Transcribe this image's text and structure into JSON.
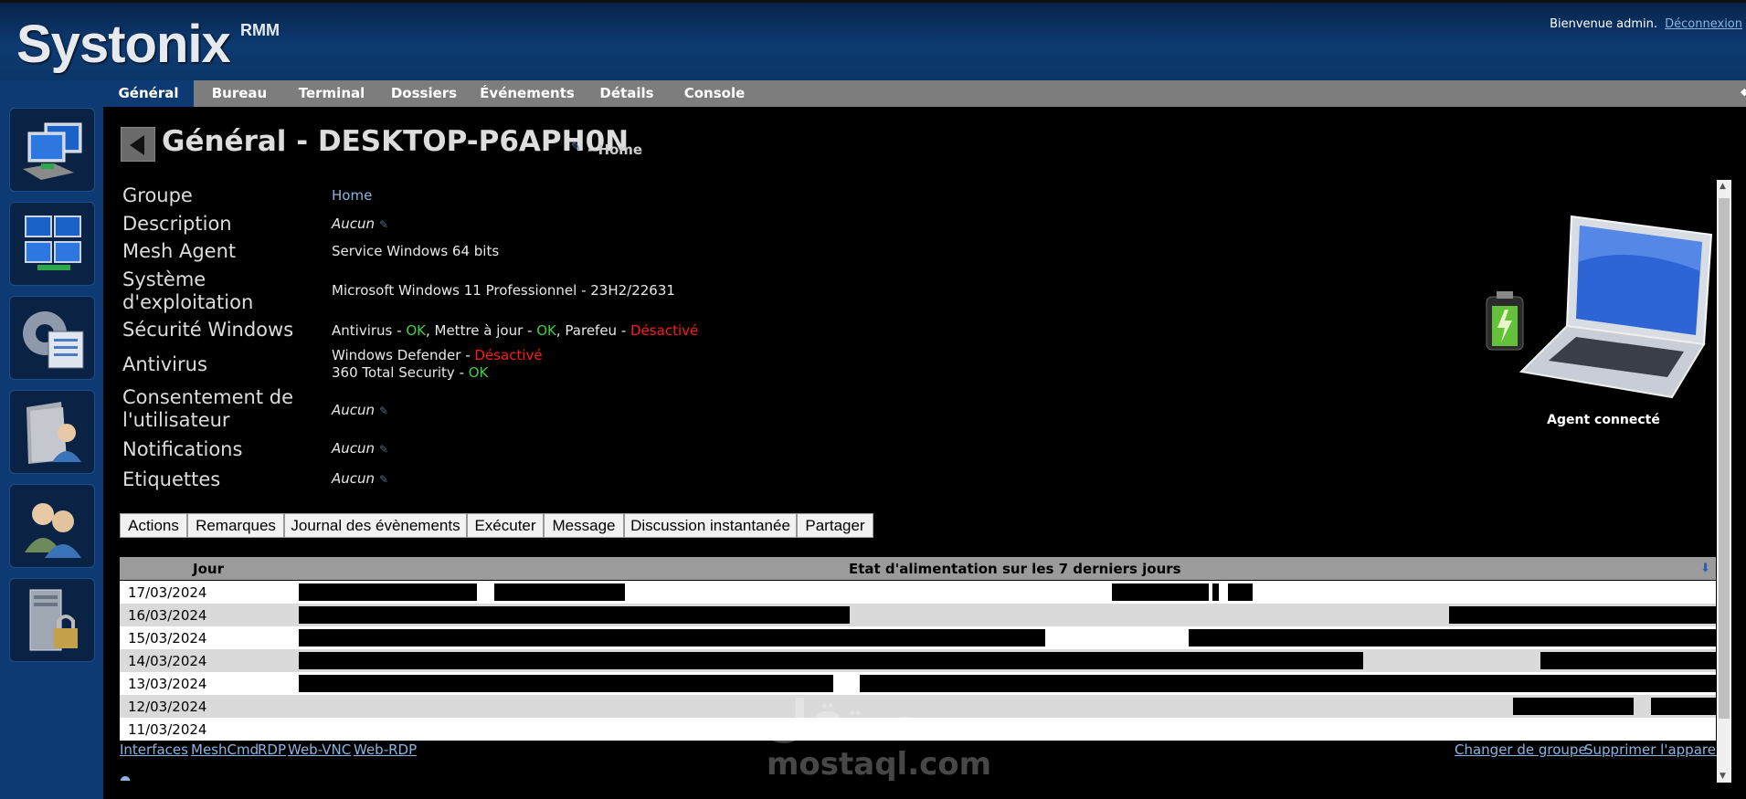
{
  "header": {
    "app_name": "Systonix",
    "app_suffix": "RMM",
    "welcome": "Bienvenue admin.",
    "logout": "Déconnexion"
  },
  "sidebar": {
    "items": [
      {
        "icon": "computers-network-icon"
      },
      {
        "icon": "multi-desktop-icon"
      },
      {
        "icon": "settings-gear-icon"
      },
      {
        "icon": "user-folder-icon"
      },
      {
        "icon": "users-icon"
      },
      {
        "icon": "server-lock-icon"
      }
    ]
  },
  "tabs": [
    {
      "label": "Général",
      "active": true
    },
    {
      "label": "Bureau"
    },
    {
      "label": "Terminal"
    },
    {
      "label": "Dossiers"
    },
    {
      "label": "Événements"
    },
    {
      "label": "Détails"
    },
    {
      "label": "Console"
    }
  ],
  "page": {
    "title": "Général - DESKTOP-P6APH0N",
    "group_suffix": "- Home"
  },
  "info": {
    "group_label": "Groupe",
    "group_value": "Home",
    "description_label": "Description",
    "description_value": "Aucun",
    "mesh_agent_label": "Mesh Agent",
    "mesh_agent_value": "Service Windows 64 bits",
    "os_label_1": "Système",
    "os_label_2": "d'exploitation",
    "os_value": "Microsoft Windows 11 Professionnel - 23H2/22631",
    "security_label": "Sécurité Windows",
    "security": {
      "antivirus": "Antivirus",
      "antivirus_status": "OK",
      "update": "Mettre à jour",
      "update_status": "OK",
      "firewall": "Parefeu",
      "firewall_status": "Désactivé"
    },
    "antivirus_label": "Antivirus",
    "antivirus_list": [
      {
        "name": "Windows Defender",
        "status": "Désactivé"
      },
      {
        "name": "360 Total Security",
        "status": "OK"
      }
    ],
    "consent_label_1": "Consentement de",
    "consent_label_2": "l'utilisateur",
    "consent_value": "Aucun",
    "notifications_label": "Notifications",
    "notifications_value": "Aucun",
    "tags_label": "Etiquettes",
    "tags_value": "Aucun"
  },
  "agent": {
    "status": "Agent connecté"
  },
  "actions": [
    "Actions",
    "Remarques",
    "Journal des évènements",
    "Exécuter",
    "Message",
    "Discussion instantanée",
    "Partager"
  ],
  "power": {
    "col_day": "Jour",
    "title": "Etat d'alimentation sur les 7 derniers jours",
    "rows": [
      {
        "date": "17/03/2024",
        "on_ranges": [
          [
            0.0,
            0.126
          ],
          [
            0.138,
            0.23
          ],
          [
            0.574,
            0.642
          ],
          [
            0.645,
            0.649
          ],
          [
            0.656,
            0.673
          ]
        ]
      },
      {
        "date": "16/03/2024",
        "on_ranges": [
          [
            0.0,
            0.389
          ],
          [
            0.812,
            1.0
          ]
        ]
      },
      {
        "date": "15/03/2024",
        "on_ranges": [
          [
            0.0,
            0.527
          ],
          [
            0.628,
            1.0
          ]
        ]
      },
      {
        "date": "14/03/2024",
        "on_ranges": [
          [
            0.0,
            0.751
          ],
          [
            0.876,
            1.0
          ]
        ]
      },
      {
        "date": "13/03/2024",
        "on_ranges": [
          [
            0.0,
            0.377
          ],
          [
            0.396,
            1.0
          ]
        ]
      },
      {
        "date": "12/03/2024",
        "on_ranges": [
          [
            0.857,
            0.942
          ],
          [
            0.954,
            1.0
          ]
        ]
      },
      {
        "date": "11/03/2024",
        "on_ranges": []
      }
    ]
  },
  "footer": {
    "left_links": [
      "Interfaces",
      "MeshCmd",
      "RDP",
      "Web-VNC",
      "Web-RDP"
    ],
    "right_links": [
      "Changer de groupe",
      "Supprimer l'appareil"
    ]
  },
  "watermark": {
    "arabic": "مستقل",
    "latin": "mostaql.com"
  }
}
